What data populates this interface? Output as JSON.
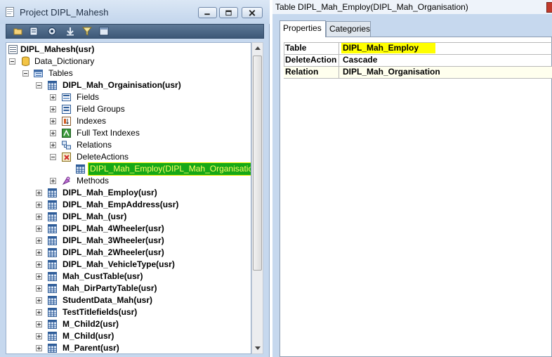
{
  "project_window": {
    "title": "Project DIPL_Mahesh",
    "buttons": {
      "minimize": "minimize",
      "maximize": "maximize",
      "close": "close"
    },
    "toolbar": [
      "open-folder-icon",
      "properties-icon",
      "compile-icon",
      "import-icon",
      "filter-icon",
      "layout-icon"
    ]
  },
  "tree": {
    "root": "DIPL_Mahesh(usr)",
    "data_dictionary": "Data_Dictionary",
    "tables": "Tables",
    "org_table": "DIPL_Mah_Orgainisation(usr)",
    "org_children": {
      "fields": "Fields",
      "field_groups": "Field Groups",
      "indexes": "Indexes",
      "full_text_indexes": "Full Text Indexes",
      "relations": "Relations",
      "delete_actions": "DeleteActions",
      "selected_action": "DIPL_Mah_Employ(DIPL_Mah_Organisation",
      "methods": "Methods"
    },
    "other_tables": [
      "DIPL_Mah_Employ(usr)",
      "DIPL_Mah_EmpAddress(usr)",
      "DIPL_Mah_(usr)",
      "DIPL_Mah_4Wheeler(usr)",
      "DIPL_Mah_3Wheeler(usr)",
      "DIPL_Mah_2Wheeler(usr)",
      "DIPL_Mah_VehicleType(usr)",
      "Mah_CustTable(usr)",
      "Mah_DirPartyTable(usr)",
      "StudentData_Mah(usr)",
      "TestTitlefields(usr)",
      "M_Child2(usr)",
      "M_Child(usr)",
      "M_Parent(usr)"
    ]
  },
  "properties_window": {
    "title": "Table DIPL_Mah_Employ(DIPL_Mah_Organisation)",
    "tabs": [
      "Properties",
      "Categories"
    ],
    "rows": [
      {
        "name": "Table",
        "value": "DIPL_Mah_Employ"
      },
      {
        "name": "DeleteAction",
        "value": "Cascade"
      },
      {
        "name": "Relation",
        "value": "DIPL_Mah_Organisation"
      }
    ]
  },
  "colors": {
    "window_frame": "#c6d8ee",
    "highlight_yellow": "#ffff00",
    "selection_green": "#16a816",
    "relation_row_bg": "#ffffee"
  }
}
